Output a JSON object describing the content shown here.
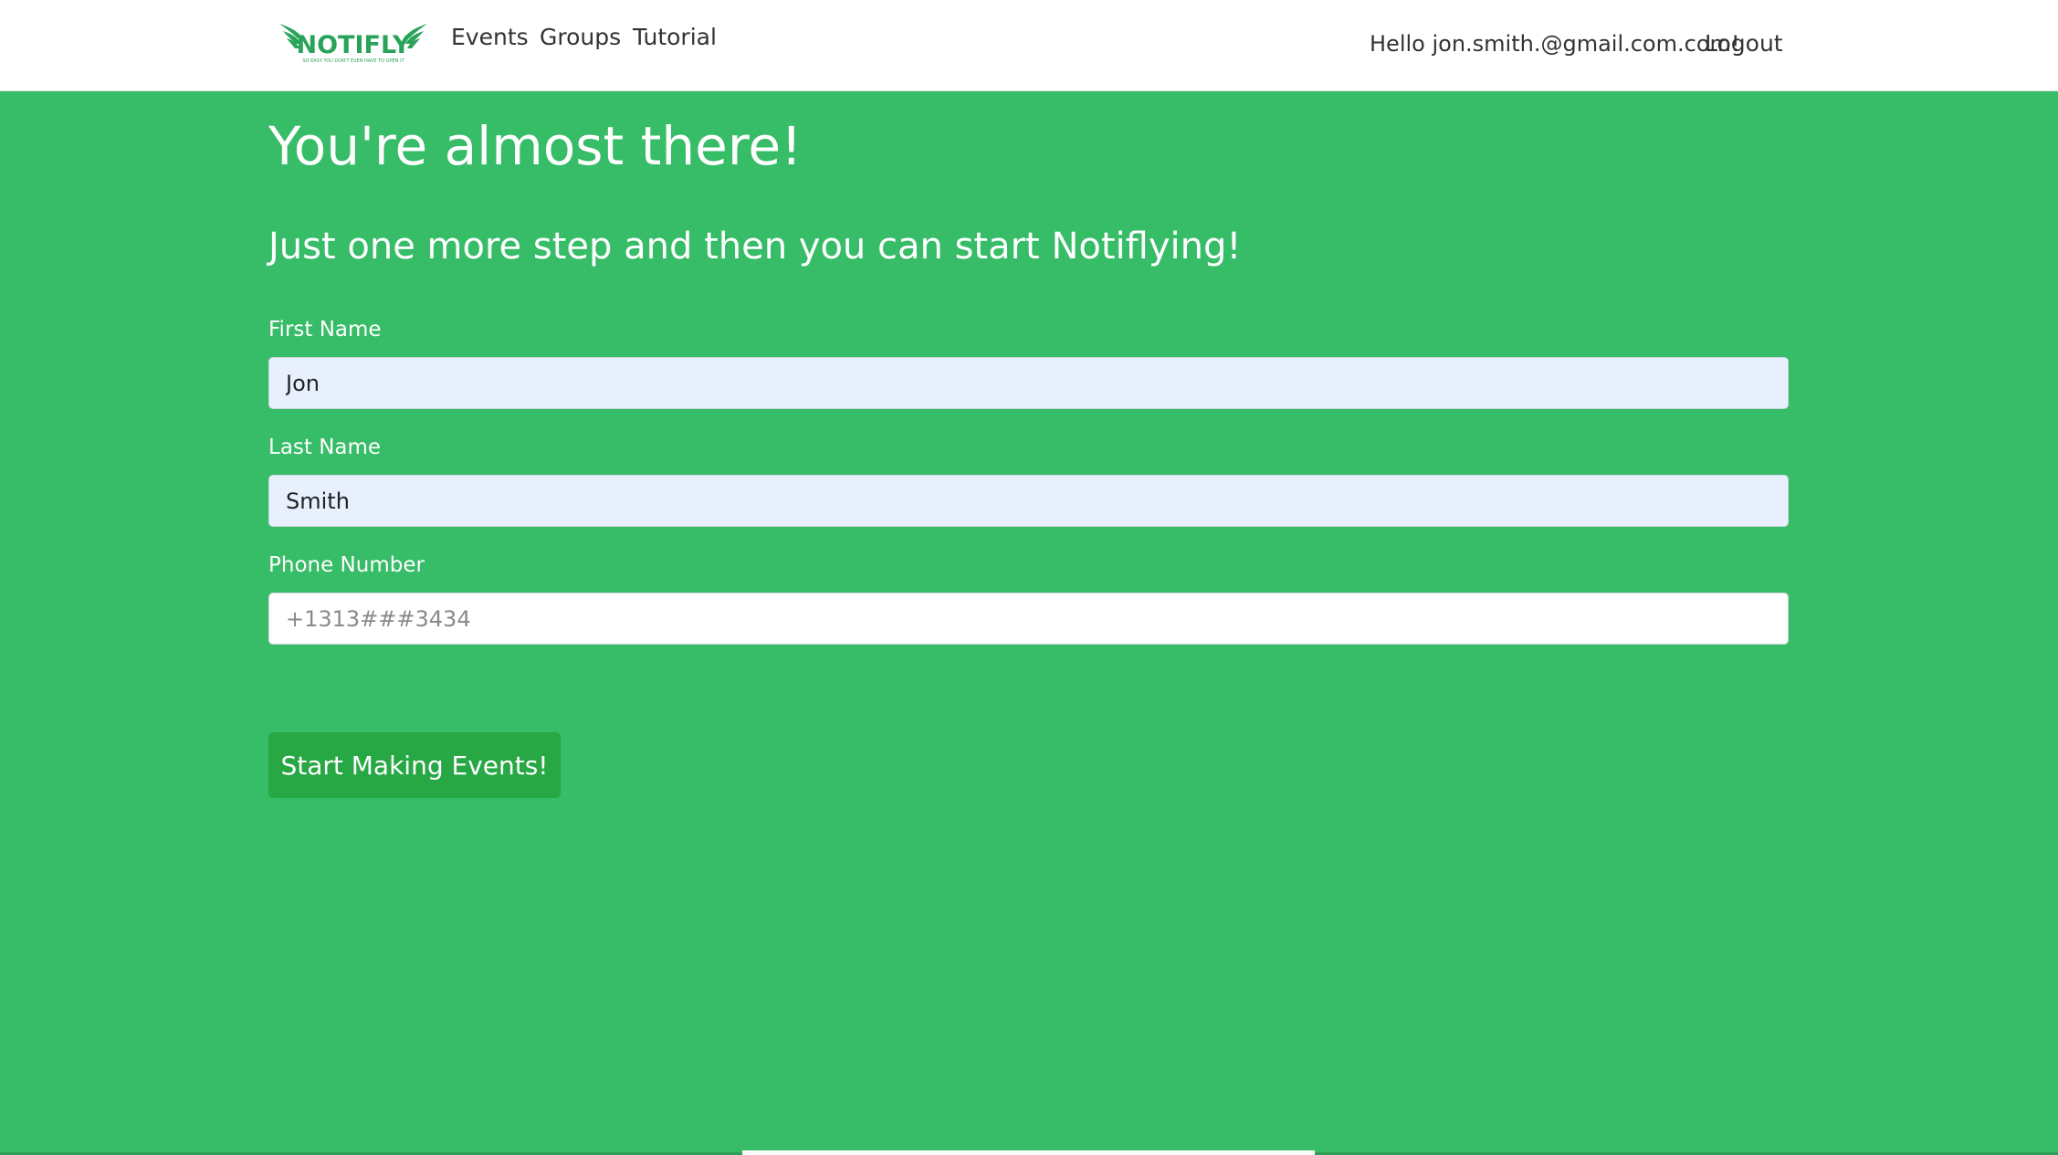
{
  "brand": {
    "logo_text": "NOTIFLY",
    "logo_tagline": "SO EASY YOU DON'T EVEN HAVE TO OPEN IT",
    "logo_color": "#2aa35a"
  },
  "nav": {
    "links": [
      "Events",
      "Groups",
      "Tutorial"
    ],
    "greeting": "Hello jon.smith.@gmail.com.com!",
    "logout": "Logout"
  },
  "page": {
    "title": "You're almost there!",
    "subtitle": "Just one more step and then you can start Notiflying!"
  },
  "form": {
    "first_name": {
      "label": "First Name",
      "value": "Jon"
    },
    "last_name": {
      "label": "Last Name",
      "value": "Smith"
    },
    "phone": {
      "label": "Phone Number",
      "value": "",
      "placeholder": "+1313###3434"
    },
    "submit_label": "Start Making Events!"
  },
  "colors": {
    "background": "#37bc67",
    "button": "#28a745",
    "navbar": "#ffffff",
    "autofill": "#e8f0fe"
  }
}
